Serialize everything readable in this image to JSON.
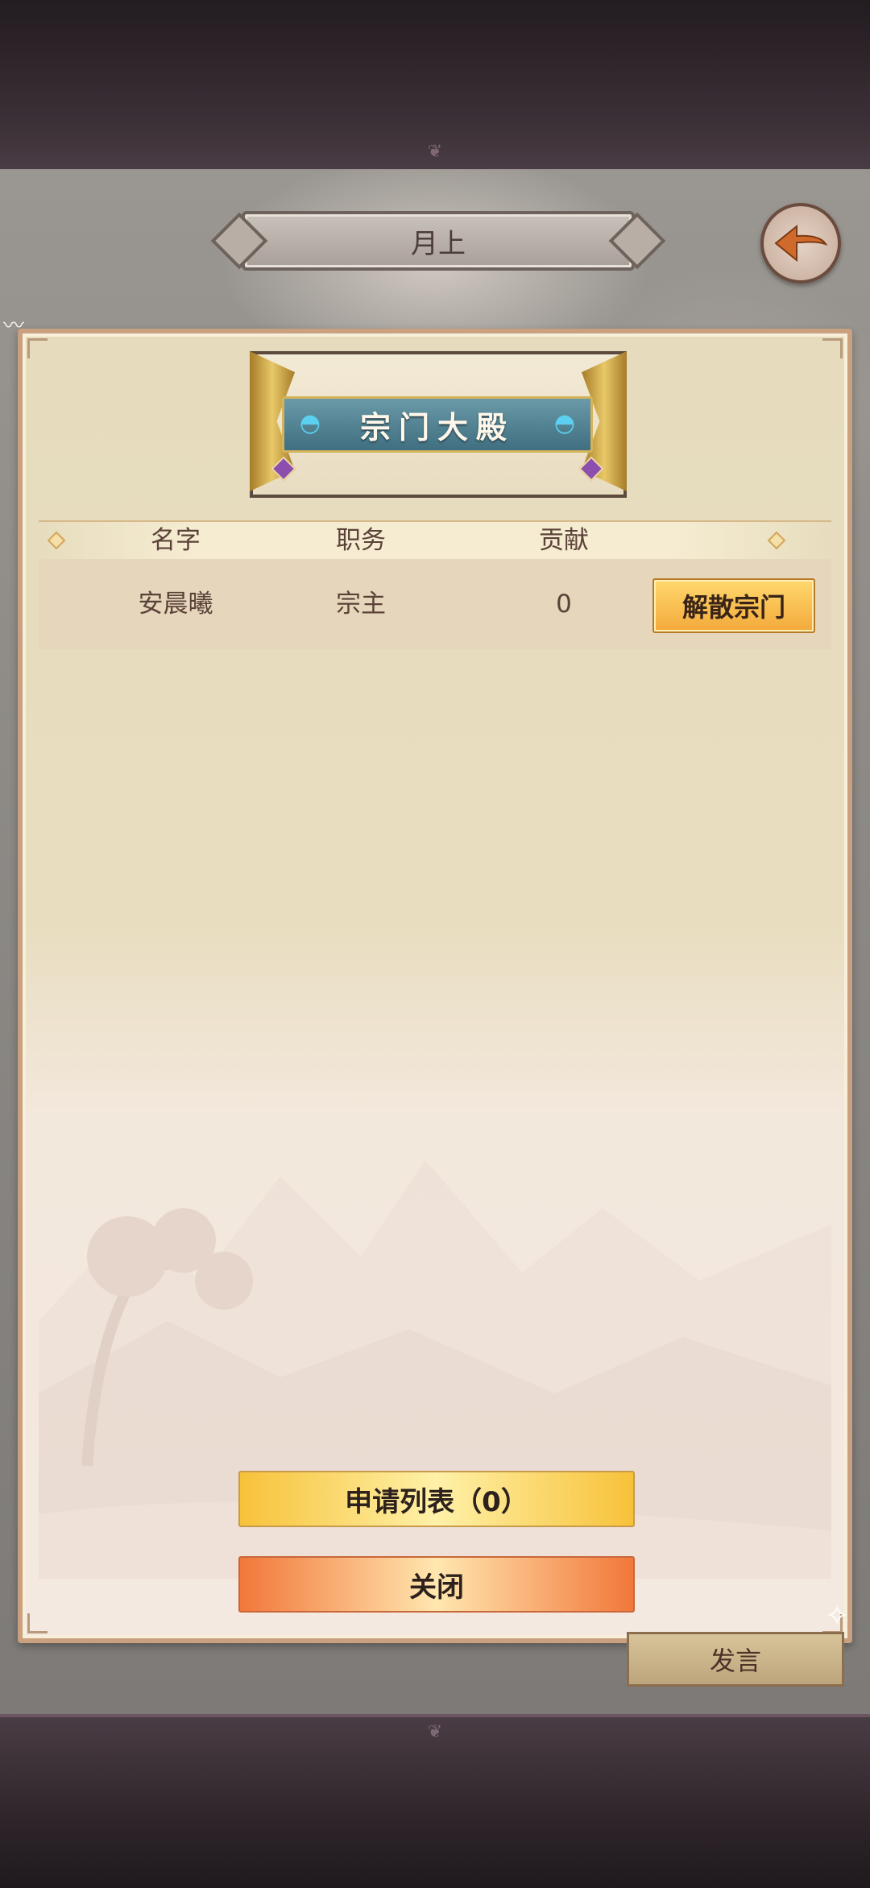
{
  "header": {
    "title": "月上"
  },
  "panel": {
    "banner_title": "宗门大殿",
    "columns": [
      "名字",
      "职务",
      "贡献"
    ],
    "members": [
      {
        "name": "安晨曦",
        "position": "宗主",
        "contribution": "0"
      }
    ],
    "dissolve_label": "解散宗门",
    "apply_list_label": "申请列表（0）",
    "close_label": "关闭"
  },
  "chat": {
    "speak_label": "发言"
  },
  "colors": {
    "panel_bg": "#e8ddbf",
    "panel_border": "#c9a080",
    "gold_button": "#f3a93a",
    "orange_button": "#f2773a",
    "banner_teal": "#3f6f80"
  },
  "icons": [
    "back-arrow-icon",
    "fan-icon",
    "gem-icon",
    "fairy-icon",
    "bird-icon",
    "diamond-icon"
  ]
}
